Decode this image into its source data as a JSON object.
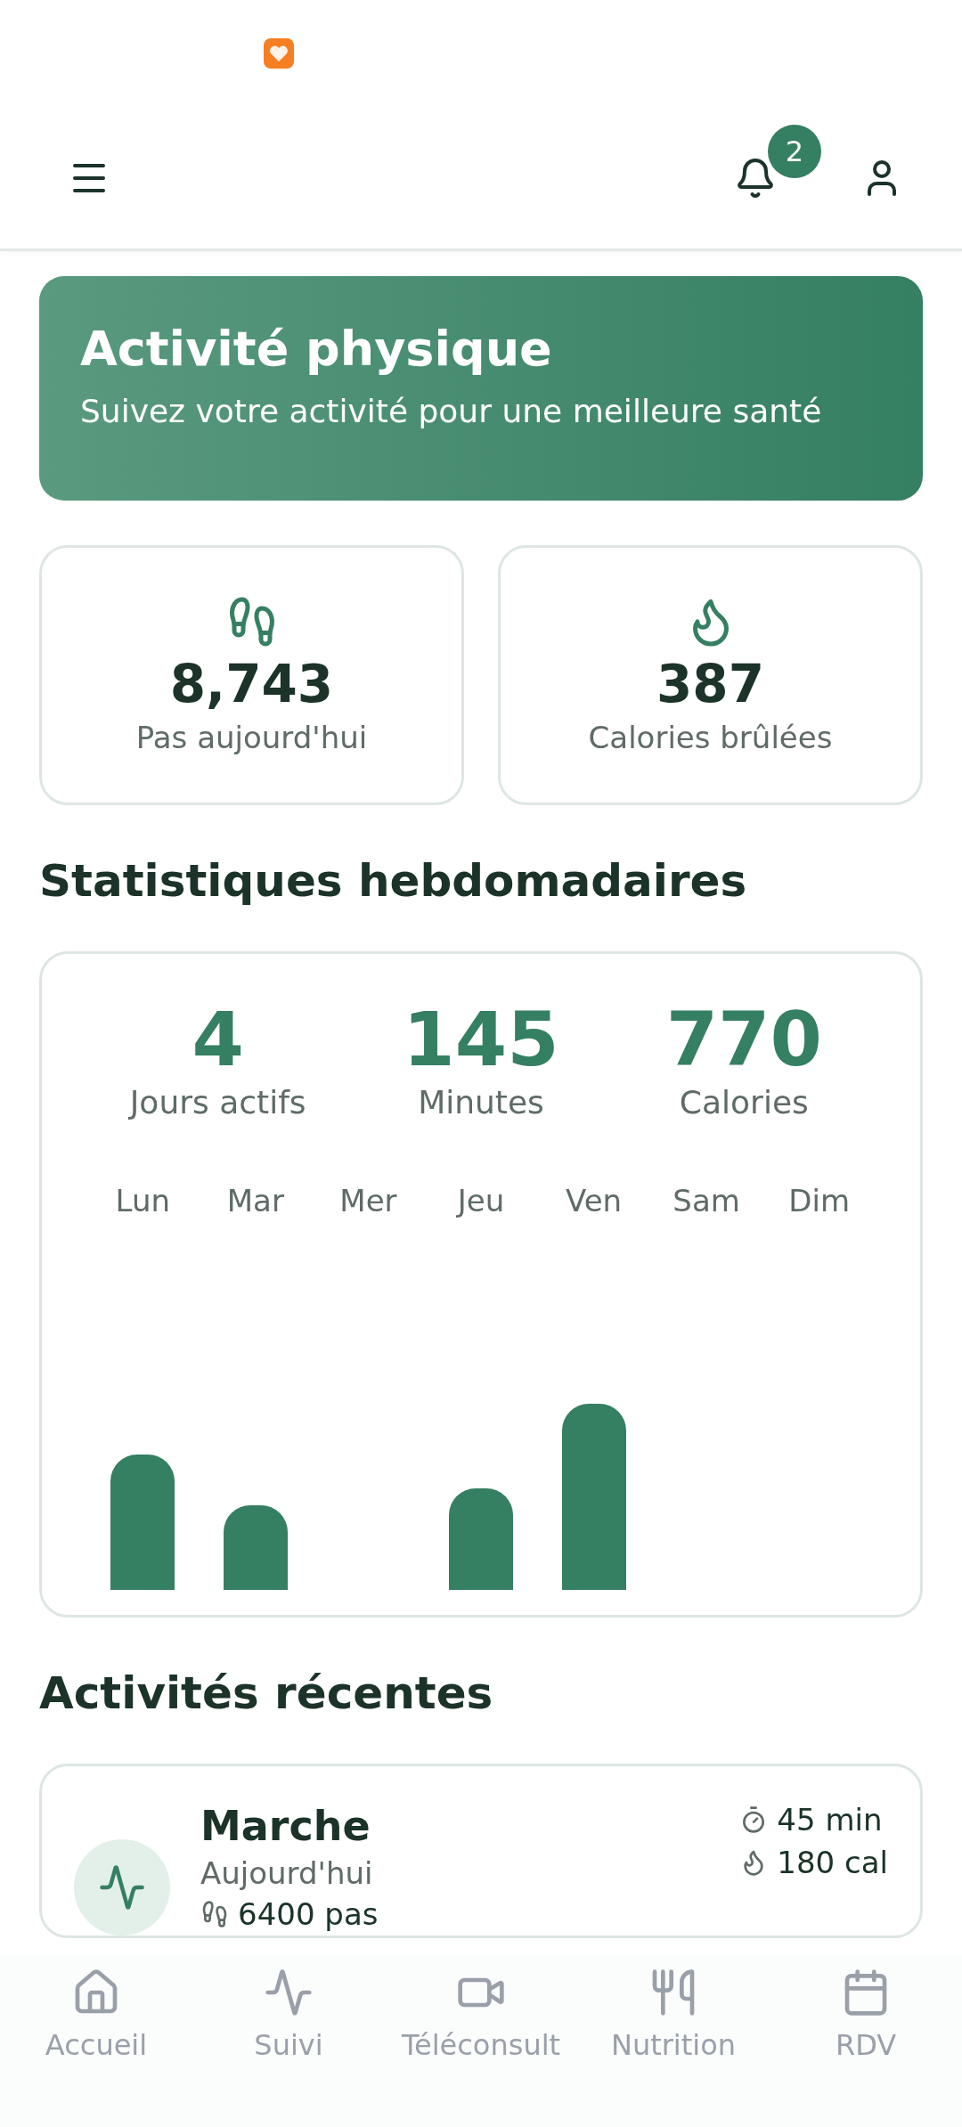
{
  "header": {
    "notification_count": "2"
  },
  "banner": {
    "title": "Activité physique",
    "subtitle": "Suivez votre activité pour une meilleure santé"
  },
  "today_stats": [
    {
      "kind": "steps",
      "value": "8,743",
      "label": "Pas aujourd'hui"
    },
    {
      "kind": "calories",
      "value": "387",
      "label": "Calories brûlées"
    }
  ],
  "weekly": {
    "title": "Statistiques hebdomadaires",
    "summary": [
      {
        "value": "4",
        "label": "Jours actifs"
      },
      {
        "value": "145",
        "label": "Minutes"
      },
      {
        "value": "770",
        "label": "Calories"
      }
    ],
    "days": [
      {
        "label": "Lun",
        "level": 0.4
      },
      {
        "label": "Mar",
        "level": 0.25
      },
      {
        "label": "Mer"
      },
      {
        "label": "Jeu",
        "level": 0.3
      },
      {
        "label": "Ven",
        "level": 0.55
      },
      {
        "label": "Sam"
      },
      {
        "label": "Dim"
      }
    ]
  },
  "recent": {
    "title": "Activités récentes",
    "activities": [
      {
        "name": "Marche",
        "date": "Aujourd'hui",
        "steps": "6400 pas",
        "duration": "45 min",
        "calories": "180 cal"
      }
    ]
  },
  "bottom_nav": [
    {
      "kind": "home",
      "label": "Accueil",
      "selected": false
    },
    {
      "kind": "activity",
      "label": "Suivi",
      "selected": false
    },
    {
      "kind": "video",
      "label": "Téléconsult",
      "selected": false
    },
    {
      "kind": "food",
      "label": "Nutrition",
      "selected": false
    },
    {
      "kind": "calendar",
      "label": "RDV",
      "selected": false
    }
  ]
}
